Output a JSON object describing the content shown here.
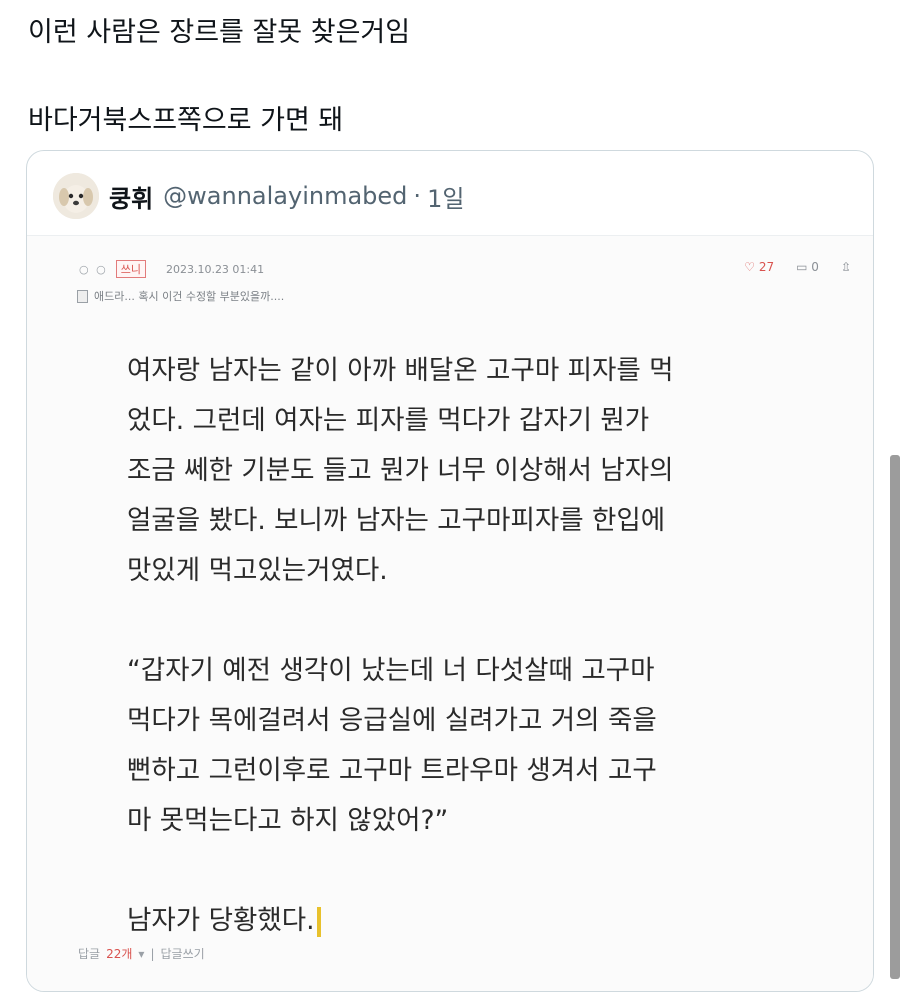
{
  "tweet": {
    "line1": "이런 사람은 장르를 잘못 찾은거임",
    "line2": "바다거북스프쪽으로 가면 돼"
  },
  "quote": {
    "name": "쿵휘",
    "handle": "@wannalayinmabed",
    "separator": "·",
    "time": "1일",
    "shot": {
      "circles": "○ ○",
      "tag": "쓰니",
      "date": "2023.10.23 01:41",
      "likes": "27",
      "comments": "0",
      "share": "⇫",
      "subtitle": "애드라... 혹시 이건 수정할 부분있을까....",
      "lines": [
        "여자랑 남자는 같이 아까 배달온 고구마 피자를 먹",
        "었다. 그런데 여자는 피자를 먹다가 갑자기 뭔가",
        "조금 쎄한 기분도 들고 뭔가 너무 이상해서 남자의",
        "얼굴을 봤다. 보니까 남자는 고구마피자를 한입에",
        "맛있게 먹고있는거였다.",
        "",
        "“갑자기 예전 생각이 났는데 너 다섯살때 고구마",
        "먹다가 목에걸려서 응급실에 실려가고 거의 죽을",
        "뻔하고 그런이후로 고구마 트라우마 생겨서 고구",
        "마 못먹는다고 하지 않았어?”",
        "",
        "남자가 당황했다."
      ],
      "footer_label": "답글",
      "footer_count": "22개",
      "footer_arrow": "▾",
      "footer_sep": "|",
      "footer_write": "답글쓰기"
    }
  }
}
